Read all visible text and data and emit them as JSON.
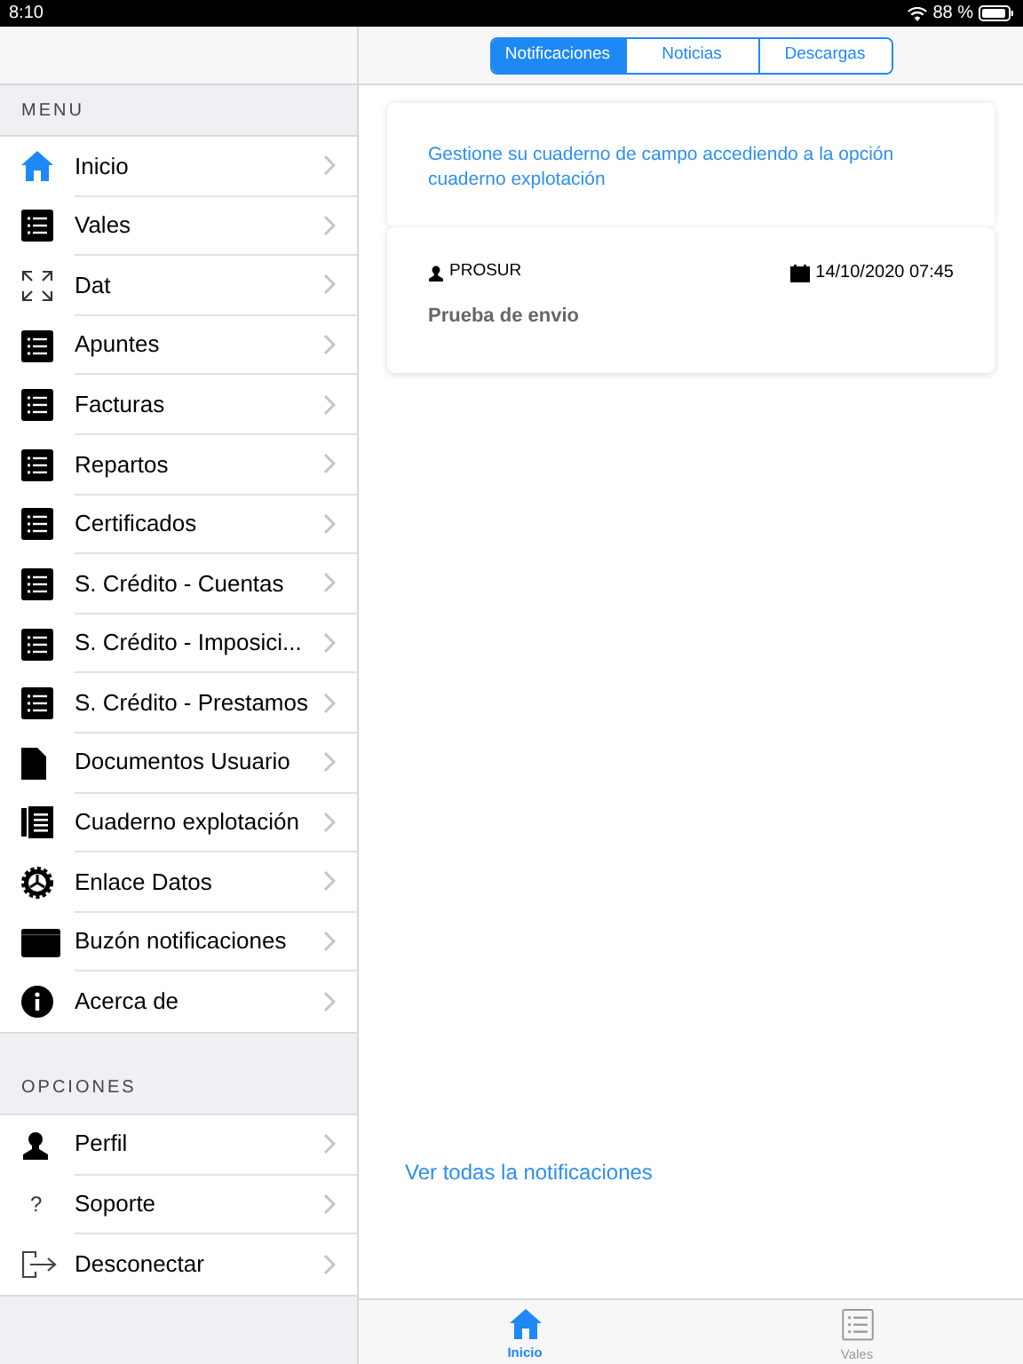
{
  "status_bar": {
    "time": "8:10",
    "battery": "88 %"
  },
  "tabs": [
    {
      "label": "Notificaciones",
      "selected": true
    },
    {
      "label": "Noticias",
      "selected": false
    },
    {
      "label": "Descargas",
      "selected": false
    }
  ],
  "sidebar": {
    "sections": [
      {
        "title": "MENU",
        "items": [
          {
            "label": "Inicio",
            "kind": "home"
          },
          {
            "label": "Vales",
            "kind": "list"
          },
          {
            "label": "Dat",
            "kind": "expand"
          },
          {
            "label": "Apuntes",
            "kind": "list"
          },
          {
            "label": "Facturas",
            "kind": "list"
          },
          {
            "label": "Repartos",
            "kind": "list"
          },
          {
            "label": "Certificados",
            "kind": "list"
          },
          {
            "label": "S. Crédito - Cuentas",
            "kind": "list"
          },
          {
            "label": "S. Crédito - Imposici...",
            "kind": "list"
          },
          {
            "label": "S. Crédito - Prestamos",
            "kind": "list"
          },
          {
            "label": "Documentos Usuario",
            "kind": "document"
          },
          {
            "label": "Cuaderno explotación",
            "kind": "notebook"
          },
          {
            "label": "Enlace Datos",
            "kind": "gear"
          },
          {
            "label": "Buzón notificaciones",
            "kind": "box"
          },
          {
            "label": "Acerca de",
            "kind": "info"
          }
        ]
      },
      {
        "title": "OPCIONES",
        "items": [
          {
            "label": "Perfil",
            "kind": "person"
          },
          {
            "label": "Soporte",
            "kind": "glyph",
            "glyph": "?"
          },
          {
            "label": "Desconectar",
            "kind": "logout"
          }
        ]
      }
    ]
  },
  "notice": "Gestione su cuaderno de campo accediendo a la opción cuaderno explotación",
  "notifications": [
    {
      "sender": "PROSUR",
      "date": "14/10/2020 07:45",
      "message": "Prueba de envio"
    }
  ],
  "see_all_link": "Ver todas la notificaciones",
  "tab_bar": [
    {
      "label": "Inicio",
      "kind": "home",
      "selected": true
    },
    {
      "label": "Vales",
      "kind": "list",
      "selected": false
    }
  ]
}
